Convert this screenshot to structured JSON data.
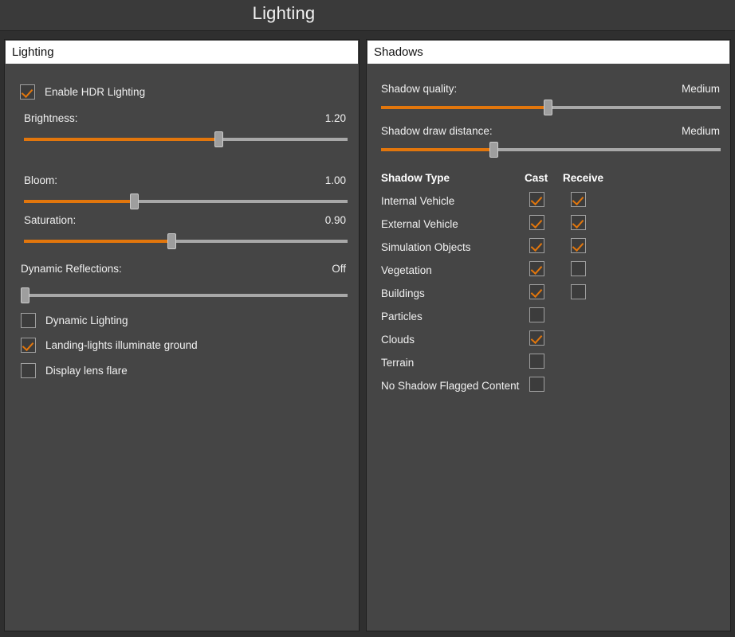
{
  "window": {
    "title": "Lighting"
  },
  "theme": {
    "accent": "#e2760c",
    "panel_bg": "#454545",
    "titlebar_bg": "#3a3a3a",
    "header_bg": "#ffffff",
    "text": "#f0f0f0",
    "track": "#a8a8a8"
  },
  "lighting_panel": {
    "header": "Lighting",
    "enable_hdr": {
      "label": "Enable HDR Lighting",
      "checked": true
    },
    "sliders": [
      {
        "label": "Brightness:",
        "value": "1.20",
        "percent": 60
      },
      {
        "label": "Bloom:",
        "value": "1.00",
        "percent": 34
      },
      {
        "label": "Saturation:",
        "value": "0.90",
        "percent": 45.5
      }
    ],
    "dynamic_reflections": {
      "label": "Dynamic Reflections:",
      "value": "Off",
      "percent": 0
    },
    "checkboxes": [
      {
        "label": "Dynamic Lighting",
        "checked": false
      },
      {
        "label": "Landing-lights illuminate ground",
        "checked": true
      },
      {
        "label": "Display lens flare",
        "checked": false
      }
    ]
  },
  "shadows_panel": {
    "header": "Shadows",
    "sliders": [
      {
        "label": "Shadow quality:",
        "value": "Medium",
        "percent": 49
      },
      {
        "label": "Shadow draw distance:",
        "value": "Medium",
        "percent": 33
      }
    ],
    "table": {
      "columns": [
        "Shadow Type",
        "Cast",
        "Receive"
      ],
      "rows": [
        {
          "name": "Internal Vehicle",
          "cast": true,
          "receive": true
        },
        {
          "name": "External Vehicle",
          "cast": true,
          "receive": true
        },
        {
          "name": "Simulation Objects",
          "cast": true,
          "receive": true
        },
        {
          "name": "Vegetation",
          "cast": true,
          "receive": false
        },
        {
          "name": "Buildings",
          "cast": true,
          "receive": false
        },
        {
          "name": "Particles",
          "cast": false,
          "receive": null
        },
        {
          "name": "Clouds",
          "cast": true,
          "receive": null
        },
        {
          "name": "Terrain",
          "cast": false,
          "receive": null
        },
        {
          "name": "No Shadow Flagged Content",
          "cast": false,
          "receive": null
        }
      ]
    }
  }
}
